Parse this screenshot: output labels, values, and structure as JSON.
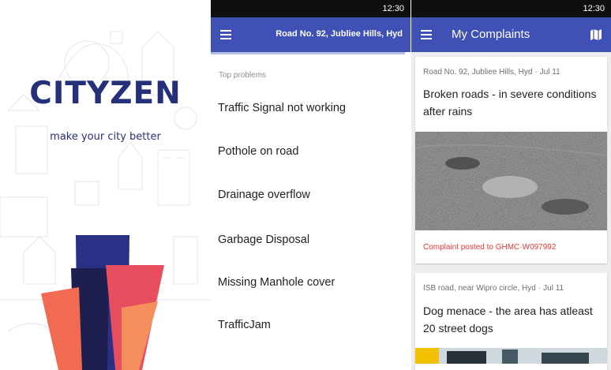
{
  "splash": {
    "logo": "CITYZEN",
    "tagline": "make your city better",
    "bar_colors": [
      "#2b2f86",
      "#1f1f4f",
      "#e94e5f",
      "#f06b52",
      "#f58f5d"
    ]
  },
  "status_bar": {
    "time": "12:30"
  },
  "problems_screen": {
    "location_title": "Road No. 92, Jubliee Hills, Hyd",
    "section_label": "Top problems",
    "problems": [
      "Traffic Signal not working",
      "Pothole on road",
      "Drainage overflow",
      "Garbage Disposal",
      "Missing Manhole cover",
      "TrafficJam"
    ],
    "icons": {
      "menu": "menu-icon"
    }
  },
  "complaints_screen": {
    "title": "My Complaints",
    "icons": {
      "menu": "menu-icon",
      "map": "map-icon"
    },
    "complaints": [
      {
        "location": "Road No. 92, Jubliee Hills, Hyd",
        "date": "Jul 11",
        "title": "Broken roads - in severe conditions after rains",
        "status": "Complaint posted to GHMC",
        "id": "W097992"
      },
      {
        "location": "ISB road, near Wipro circle, Hyd",
        "date": "Jul 11",
        "title": "Dog menace - the area has atleast 20 street dogs"
      }
    ]
  },
  "colors": {
    "app_bar": "#3f51b5",
    "brand_text": "#25307a",
    "status_red": "#e53935",
    "status_bar": "#0f0f0f"
  }
}
